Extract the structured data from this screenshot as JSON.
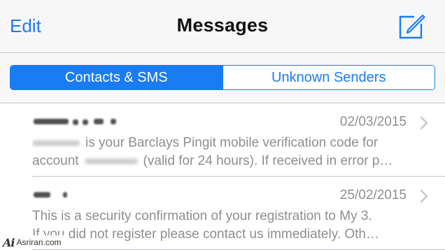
{
  "navbar": {
    "edit_label": "Edit",
    "title": "Messages",
    "compose_icon": "compose-icon"
  },
  "segments": [
    {
      "label": "Contacts & SMS",
      "selected": true
    },
    {
      "label": "Unknown Senders",
      "selected": false
    }
  ],
  "messages": [
    {
      "sender": "",
      "date": "02/03/2015",
      "preview_line1_after_redaction": "is your Barclays Pingit mobile verification code for",
      "preview_line2_before": "account",
      "preview_line2_after": "(valid for 24 hours). If received in error p…"
    },
    {
      "sender": "",
      "date": "25/02/2015",
      "preview_line1": "This is a security confirmation of your registration to My 3.",
      "preview_line2": "If you did not register please contact us immediately. Oth…"
    }
  ],
  "watermark": {
    "logo": "Ai",
    "site": "Asriran.com"
  },
  "colors": {
    "accent": "#1a7cf5",
    "secondary_text": "#8e8e93",
    "separator": "#c8c7cc"
  }
}
